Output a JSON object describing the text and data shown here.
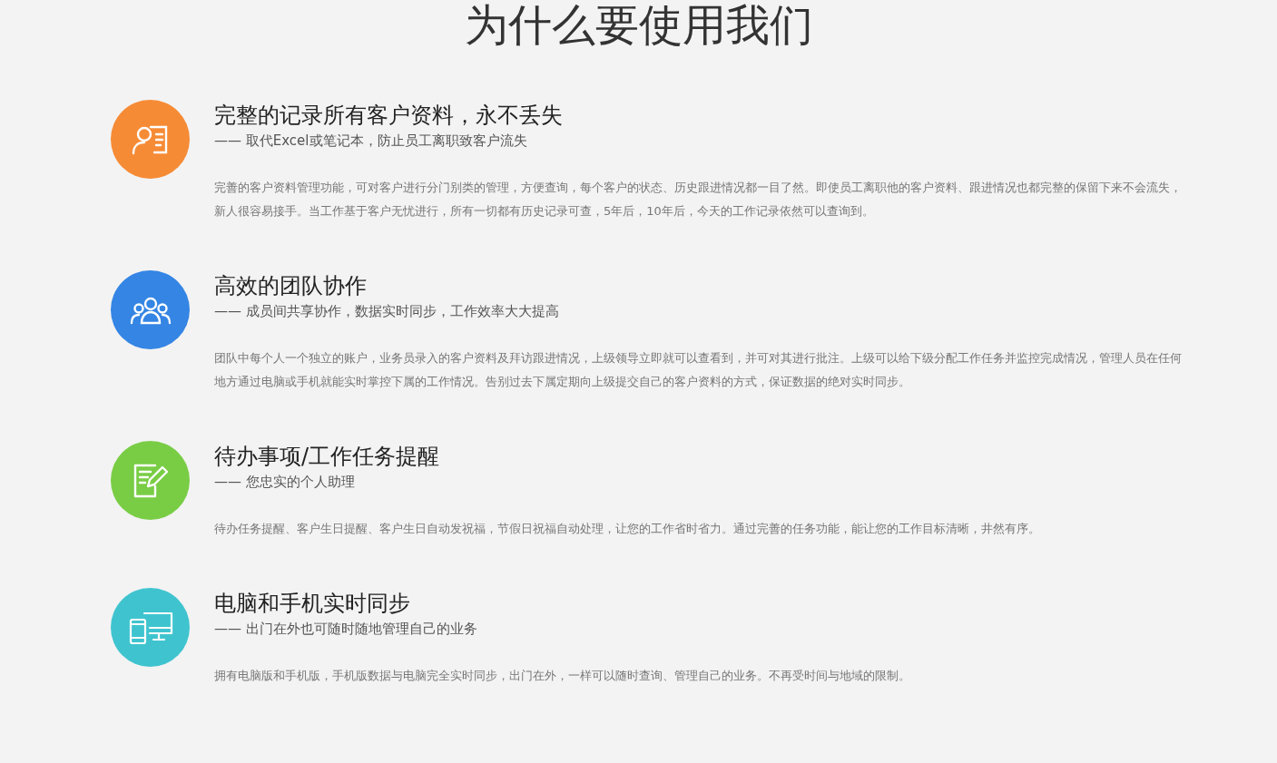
{
  "title": "为什么要使用我们",
  "features": [
    {
      "kind": "profile",
      "color": "#f68b36",
      "heading": "完整的记录所有客户资料，永不丢失",
      "subtitle": "—— 取代Excel或笔记本，防止员工离职致客户流失",
      "body": "完善的客户资料管理功能，可对客户进行分门别类的管理，方便查询，每个客户的状态、历史跟进情况都一目了然。即使员工离职他的客户资料、跟进情况也都完整的保留下来不会流失，新人很容易接手。当工作基于客户无忧进行，所有一切都有历史记录可查，5年后，10年后，今天的工作记录依然可以查询到。"
    },
    {
      "kind": "team",
      "color": "#3485e4",
      "heading": "高效的团队协作",
      "subtitle": "—— 成员间共享协作，数据实时同步，工作效率大大提高",
      "body": "团队中每个人一个独立的账户，业务员录入的客户资料及拜访跟进情况，上级领导立即就可以查看到，并可对其进行批注。上级可以给下级分配工作任务并监控完成情况，管理人员在任何地方通过电脑或手机就能实时掌控下属的工作情况。告别过去下属定期向上级提交自己的客户资料的方式，保证数据的绝对实时同步。"
    },
    {
      "kind": "edit",
      "color": "#79cd45",
      "heading": "待办事项/工作任务提醒",
      "subtitle": "—— 您忠实的个人助理",
      "body": "待办任务提醒、客户生日提醒、客户生日自动发祝福，节假日祝福自动处理，让您的工作省时省力。通过完善的任务功能，能让您的工作目标清晰，井然有序。"
    },
    {
      "kind": "devices",
      "color": "#3fc4cf",
      "heading": "电脑和手机实时同步",
      "subtitle": "—— 出门在外也可随时随地管理自己的业务",
      "body": "拥有电脑版和手机版，手机版数据与电脑完全实时同步，出门在外，一样可以随时查询、管理自己的业务。不再受时间与地域的限制。"
    }
  ]
}
